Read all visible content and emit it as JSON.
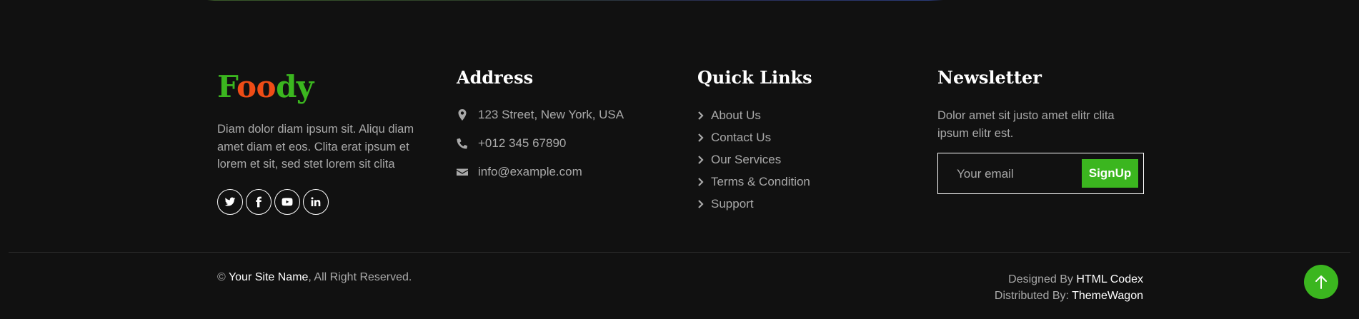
{
  "brand": {
    "name_parts": [
      "F",
      "oo",
      "dy"
    ],
    "colors": {
      "primary": "#3bb61f",
      "accent": "#ef4c16"
    }
  },
  "about": {
    "text": "Diam dolor diam ipsum sit. Aliqu diam amet diam et eos. Clita erat ipsum et lorem et sit, sed stet lorem sit clita"
  },
  "socials": [
    {
      "icon": "twitter-icon"
    },
    {
      "icon": "facebook-icon"
    },
    {
      "icon": "youtube-icon"
    },
    {
      "icon": "linkedin-icon"
    }
  ],
  "address": {
    "heading": "Address",
    "items": [
      {
        "icon": "map-marker-icon",
        "text": "123 Street, New York, USA"
      },
      {
        "icon": "phone-icon",
        "text": "+012 345 67890"
      },
      {
        "icon": "envelope-icon",
        "text": "info@example.com"
      }
    ]
  },
  "quick_links": {
    "heading": "Quick Links",
    "items": [
      "About Us",
      "Contact Us",
      "Our Services",
      "Terms & Condition",
      "Support"
    ]
  },
  "newsletter": {
    "heading": "Newsletter",
    "text": "Dolor amet sit justo amet elitr clita ipsum elitr est.",
    "placeholder": "Your email",
    "button_label": "SignUp"
  },
  "copyright": {
    "prefix": "© ",
    "site_name": "Your Site Name",
    "suffix": ", All Right Reserved."
  },
  "credits": {
    "designed_label": "Designed By ",
    "designed_by": "HTML Codex",
    "distributed_label": "Distributed By: ",
    "distributed_by": "ThemeWagon"
  },
  "back_to_top": {
    "icon": "arrow-up-icon"
  }
}
